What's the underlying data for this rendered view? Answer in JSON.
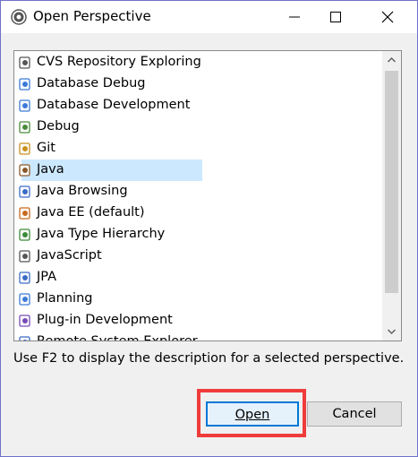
{
  "window": {
    "title": "Open Perspective"
  },
  "perspectives": [
    {
      "label": "CVS Repository Exploring",
      "icon": "cvs-repository-icon",
      "color": "#555555"
    },
    {
      "label": "Database Debug",
      "icon": "database-debug-icon",
      "color": "#3a7bd5"
    },
    {
      "label": "Database Development",
      "icon": "database-development-icon",
      "color": "#3a7bd5"
    },
    {
      "label": "Debug",
      "icon": "debug-bug-icon",
      "color": "#4a8a3a"
    },
    {
      "label": "Git",
      "icon": "git-icon",
      "color": "#c8901c"
    },
    {
      "label": "Java",
      "icon": "java-icon",
      "color": "#8a5a2a",
      "selected": true
    },
    {
      "label": "Java Browsing",
      "icon": "java-browsing-icon",
      "color": "#3a6bc5"
    },
    {
      "label": "Java EE (default)",
      "icon": "java-ee-icon",
      "color": "#c86a1c"
    },
    {
      "label": "Java Type Hierarchy",
      "icon": "type-hierarchy-icon",
      "color": "#3a8a3a"
    },
    {
      "label": "JavaScript",
      "icon": "javascript-icon",
      "color": "#555555"
    },
    {
      "label": "JPA",
      "icon": "jpa-icon",
      "color": "#3a6bc5"
    },
    {
      "label": "Planning",
      "icon": "planning-icon",
      "color": "#3a7bd5"
    },
    {
      "label": "Plug-in Development",
      "icon": "plugin-development-icon",
      "color": "#7a4ab5"
    },
    {
      "label": "Remote System Explorer",
      "icon": "remote-system-explorer-icon",
      "color": "#3a6bc5"
    }
  ],
  "description": "Use F2 to display the description for a selected perspective.",
  "buttons": {
    "open": "Open",
    "cancel": "Cancel"
  },
  "colors": {
    "selection": "#cce8ff",
    "default_button_border": "#0078d7",
    "annotation_box": "#f03b3b"
  }
}
